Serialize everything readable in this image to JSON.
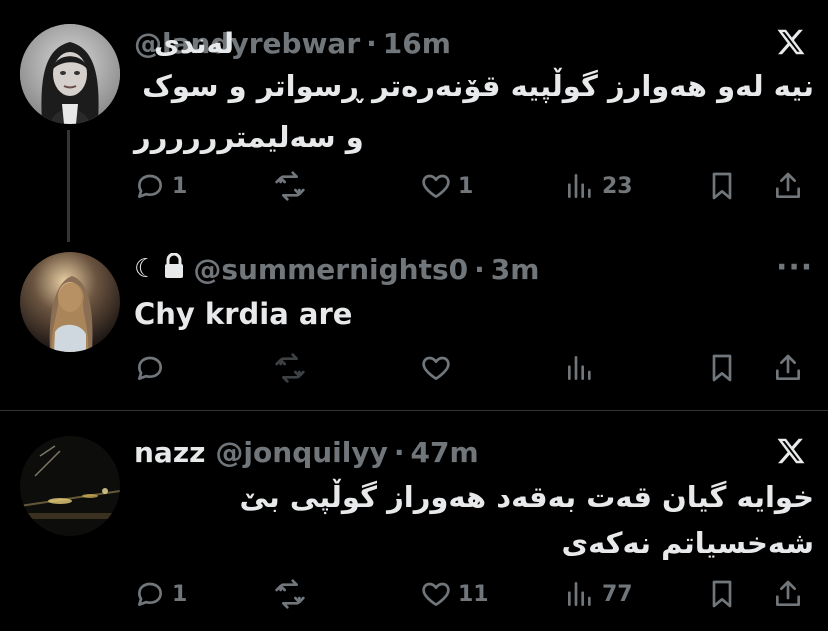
{
  "tweets": [
    {
      "name": "له‌ندی",
      "handle": "@landyrebwar",
      "time": "16m",
      "text": "نیە لەو هەوارز گوڵپیە قۆنەرەتر ڕسواتر و سوک و سەلیمترررررر",
      "line1": "نیە لەو هەوارز گوڵپیە قۆنەرەتر ڕسواتر و سوک",
      "line2": "و سەلیمترررررر",
      "counts": {
        "reply": "1",
        "retweet": "",
        "like": "1",
        "views": "23"
      },
      "corner_icon": "x-logo-icon"
    },
    {
      "name": "",
      "handle": "@summernights0",
      "time": "3m",
      "badges": [
        "moon-icon",
        "lock-icon"
      ],
      "text": "Chy krdia are",
      "counts": {
        "reply": "",
        "retweet": "",
        "like": "",
        "views": ""
      },
      "corner_icon": "more-icon",
      "more": "···"
    },
    {
      "name": "nazz",
      "handle": "@jonquilyy",
      "time": "47m",
      "text": "خوایە گیان قەت بەقەد هەوراز گوڵپی بێ شەخسیاتم نەکەی",
      "line1": "خوایە گیان قەت بەقەد هەوراز گوڵپی بێ",
      "line2": "شەخسیاتم نەکەی",
      "counts": {
        "reply": "1",
        "retweet": "",
        "like": "11",
        "views": "77"
      },
      "corner_icon": "x-logo-icon"
    }
  ],
  "separator": "·",
  "colors": {
    "background": "#000000",
    "text": "#e7e9ea",
    "muted": "#71767b",
    "line": "#333639"
  }
}
